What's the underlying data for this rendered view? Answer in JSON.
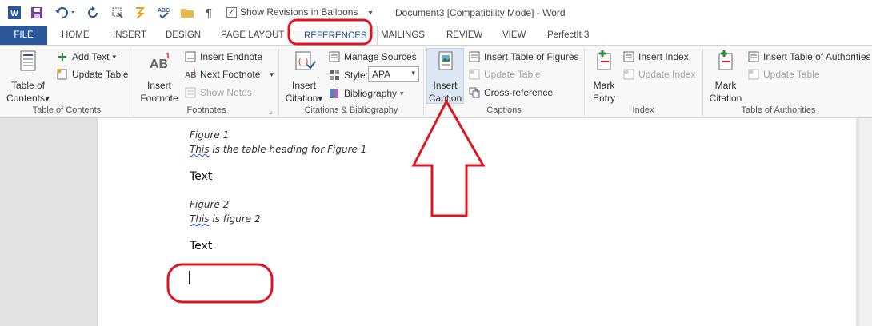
{
  "window": {
    "title": "Document3 [Compatibility Mode] - Word",
    "show_revisions_label": "Show Revisions in Balloons",
    "show_revisions_checked": true
  },
  "qat": {
    "icons": [
      "word-app-icon",
      "save-icon",
      "undo-icon",
      "redo-icon",
      "paint-icon",
      "format-painter-icon",
      "spelling-icon",
      "open-folder-icon",
      "pilcrow-icon",
      "customize-qat-icon"
    ]
  },
  "tabs": [
    "FILE",
    "HOME",
    "INSERT",
    "DESIGN",
    "PAGE LAYOUT",
    "REFERENCES",
    "MAILINGS",
    "REVIEW",
    "VIEW",
    "PerfectIt 3"
  ],
  "active_tab": "REFERENCES",
  "ribbon": {
    "toc": {
      "big_label_1": "Table of",
      "big_label_2": "Contents",
      "add_text": "Add Text",
      "update_table": "Update Table",
      "group": "Table of Contents"
    },
    "footnotes": {
      "big_label_1": "Insert",
      "big_label_2": "Footnote",
      "insert_endnote": "Insert Endnote",
      "next_footnote": "Next Footnote",
      "show_notes": "Show Notes",
      "group": "Footnotes"
    },
    "citations": {
      "big_label_1": "Insert",
      "big_label_2": "Citation",
      "manage_sources": "Manage Sources",
      "style_label": "Style:",
      "style_value": "APA",
      "bibliography": "Bibliography",
      "group": "Citations & Bibliography"
    },
    "captions": {
      "big_label_1": "Insert",
      "big_label_2": "Caption",
      "insert_table_of_figures": "Insert Table of Figures",
      "update_table": "Update Table",
      "cross_reference": "Cross-reference",
      "group": "Captions"
    },
    "index": {
      "big_label_1": "Mark",
      "big_label_2": "Entry",
      "insert_index": "Insert Index",
      "update_index": "Update Index",
      "group": "Index"
    },
    "toa": {
      "big_label_1": "Mark",
      "big_label_2": "Citation",
      "insert_toa": "Insert Table of Authorities",
      "update_table": "Update Table",
      "group": "Table of Authorities"
    }
  },
  "document": {
    "caption1_label": "Figure 1",
    "caption1_squiggle": "This",
    "caption1_rest": " is the table heading for Figure 1",
    "text1": "Text",
    "caption2_label": "Figure 2",
    "caption2_squiggle": "This",
    "caption2_rest": " is figure 2",
    "text2": "Text"
  },
  "annotations": {
    "highlight_color": "#e0141e"
  }
}
